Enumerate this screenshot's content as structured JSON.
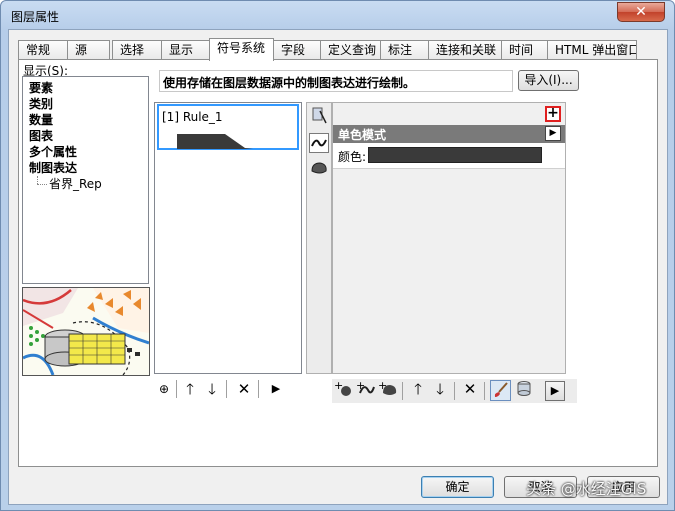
{
  "window": {
    "title": "图层属性",
    "close": "✕"
  },
  "tabs": [
    {
      "label": "常规"
    },
    {
      "label": "源"
    },
    {
      "label": "选择"
    },
    {
      "label": "显示"
    },
    {
      "label": "符号系统"
    },
    {
      "label": "字段"
    },
    {
      "label": "定义查询"
    },
    {
      "label": "标注"
    },
    {
      "label": "连接和关联"
    },
    {
      "label": "时间"
    },
    {
      "label": "HTML 弹出窗口"
    }
  ],
  "show": {
    "label": "显示(S):",
    "items": [
      "要素",
      "类别",
      "数量",
      "图表",
      "多个属性",
      "制图表达"
    ],
    "subitem": "省界_Rep"
  },
  "description": "使用存储在图层数据源中的制图表达进行绘制。",
  "import_button": "导入(I)...",
  "rule": {
    "label": "[1] Rule_1"
  },
  "side_icons": [
    "marker-layer-icon",
    "stroke-layer-icon",
    "fill-layer-icon"
  ],
  "properties": {
    "add": "+",
    "section_title": "单色模式",
    "color_label": "颜色:",
    "color_value": "#3a3a3a"
  },
  "left_toolbar": {
    "add": "⊕",
    "up": "🡑",
    "down": "🡓",
    "delete": "✕",
    "more": "▶"
  },
  "right_toolbar": {
    "up": "🡑",
    "down": "🡓",
    "delete": "✕",
    "more": "▶"
  },
  "footer": {
    "ok": "确定",
    "cancel": "取消",
    "apply": "应用"
  },
  "watermark": "头条 @水经注GIS"
}
